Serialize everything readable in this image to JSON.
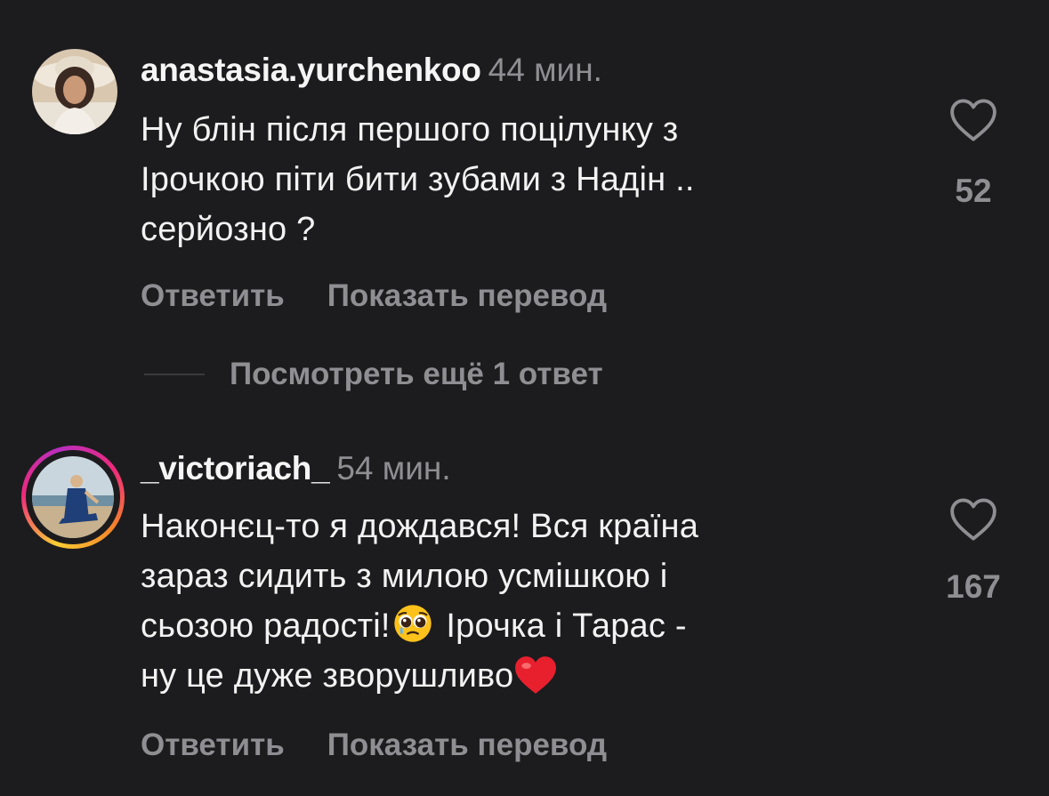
{
  "comments": [
    {
      "username": "anastasia.yurchenkoo",
      "time": "44 мин.",
      "text_lines": [
        "Ну блін після першого поцілунку з",
        "Ірочкою піти бити зубами з Надін ..",
        "серйозно ?"
      ],
      "likes": "52",
      "reply_label": "Ответить",
      "translate_label": "Показать перевод",
      "has_story_ring": false
    },
    {
      "username": "_victoriach_",
      "time": "54 мин.",
      "text_line1": "Наконєц-то я дождався! Вся країна",
      "text_line2": "зараз сидить з милою усмішкою і",
      "text_line3_a": "сьозою радості!",
      "text_line3_b": " Ірочка і Тарас -",
      "text_line4": "ну це дуже зворушливо",
      "likes": "167",
      "reply_label": "Ответить",
      "translate_label": "Показать перевод",
      "has_story_ring": true
    }
  ],
  "view_replies": "Посмотреть ещё 1 ответ",
  "icons": {
    "like": "heart-outline-icon",
    "emoji1": "pleading-face-emoji",
    "emoji2": "red-heart-emoji"
  },
  "colors": {
    "background": "#1c1c1e",
    "secondary_text": "#8e8e93",
    "primary_text": "#f2f2f2"
  }
}
